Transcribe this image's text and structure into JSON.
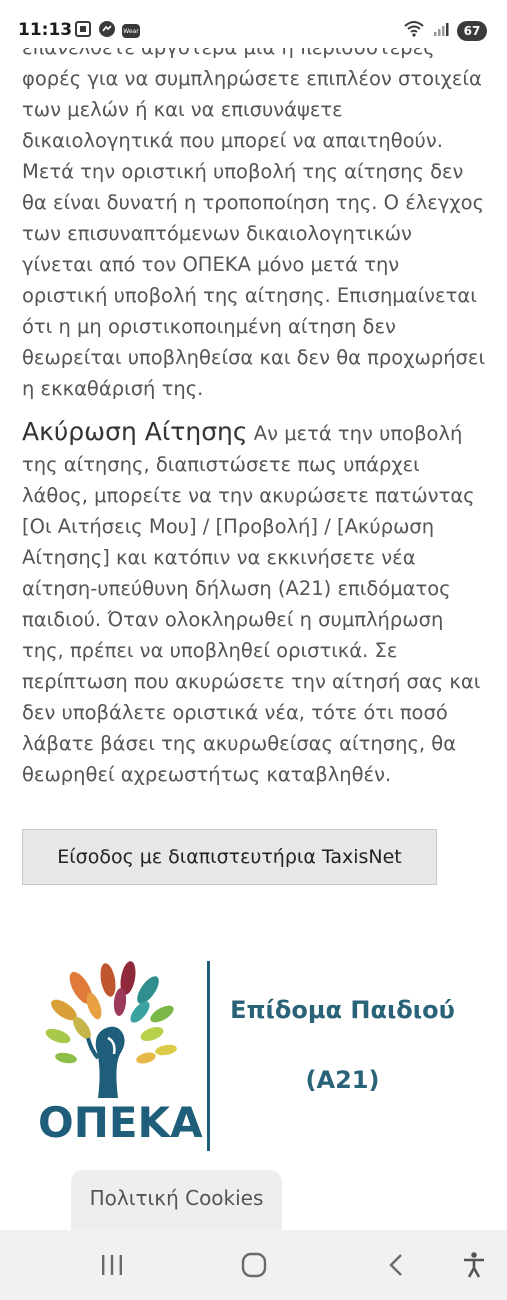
{
  "status_bar": {
    "time": "11:13",
    "battery": "67",
    "wear_label": "Wear"
  },
  "content": {
    "paragraph1": "επανέλθετε αργότερα μία ή περισσότερες φορές για να συμπληρώσετε επιπλέον στοιχεία των μελών ή και να επισυνάψετε δικαιολογητικά που μπορεί να απαιτηθούν. Μετά την οριστική υποβολή της αίτησης δεν θα είναι δυνατή η τροποποίηση της. Ο έλεγχος των επισυναπτόμενων δικαιολογητικών γίνεται από τον ΟΠΕΚΑ μόνο μετά την οριστική υποβολή της αίτησης. Επισημαίνεται ότι η μη οριστικοποιημένη αίτηση δεν θεωρείται υποβληθείσα και δεν θα προχωρήσει η εκκαθάρισή της.",
    "cancel_heading": "Ακύρωση Αίτησης",
    "paragraph2": " Αν μετά την υποβολή της αίτησης, διαπιστώσετε πως υπάρχει λάθος, μπορείτε να την ακυρώσετε πατώντας [Οι Αιτήσεις Μου] / [Προβολή] / [Ακύρωση Αίτησης] και κατόπιν να εκκινήσετε νέα αίτηση-υπεύθυνη δήλωση (Α21) επιδόματος παιδιού. Όταν ολοκληρωθεί η συμπλήρωση της, πρέπει να υποβληθεί οριστικά. Σε περίπτωση που ακυρώσετε την αίτησή σας και δεν υποβάλετε οριστικά νέα, τότε ότι ποσό λάβατε βάσει της ακυρωθείσας αίτησης, θα θεωρηθεί αχρεωστήτως καταβληθέν."
  },
  "login_button": {
    "label": "Είσοδος με διαπιστευτήρια TaxisNet"
  },
  "logo": {
    "wordmark": "ΟΠΕΚΑ",
    "benefit_title": "Επίδομα Παιδιού",
    "benefit_code": "(Α21)",
    "brand_color": "#1e5e7a"
  },
  "cookies": {
    "label": "Πολιτική Cookies"
  },
  "nav": {
    "recents": "recents-icon",
    "home": "home-icon",
    "back": "back-icon",
    "accessibility": "accessibility-icon"
  }
}
